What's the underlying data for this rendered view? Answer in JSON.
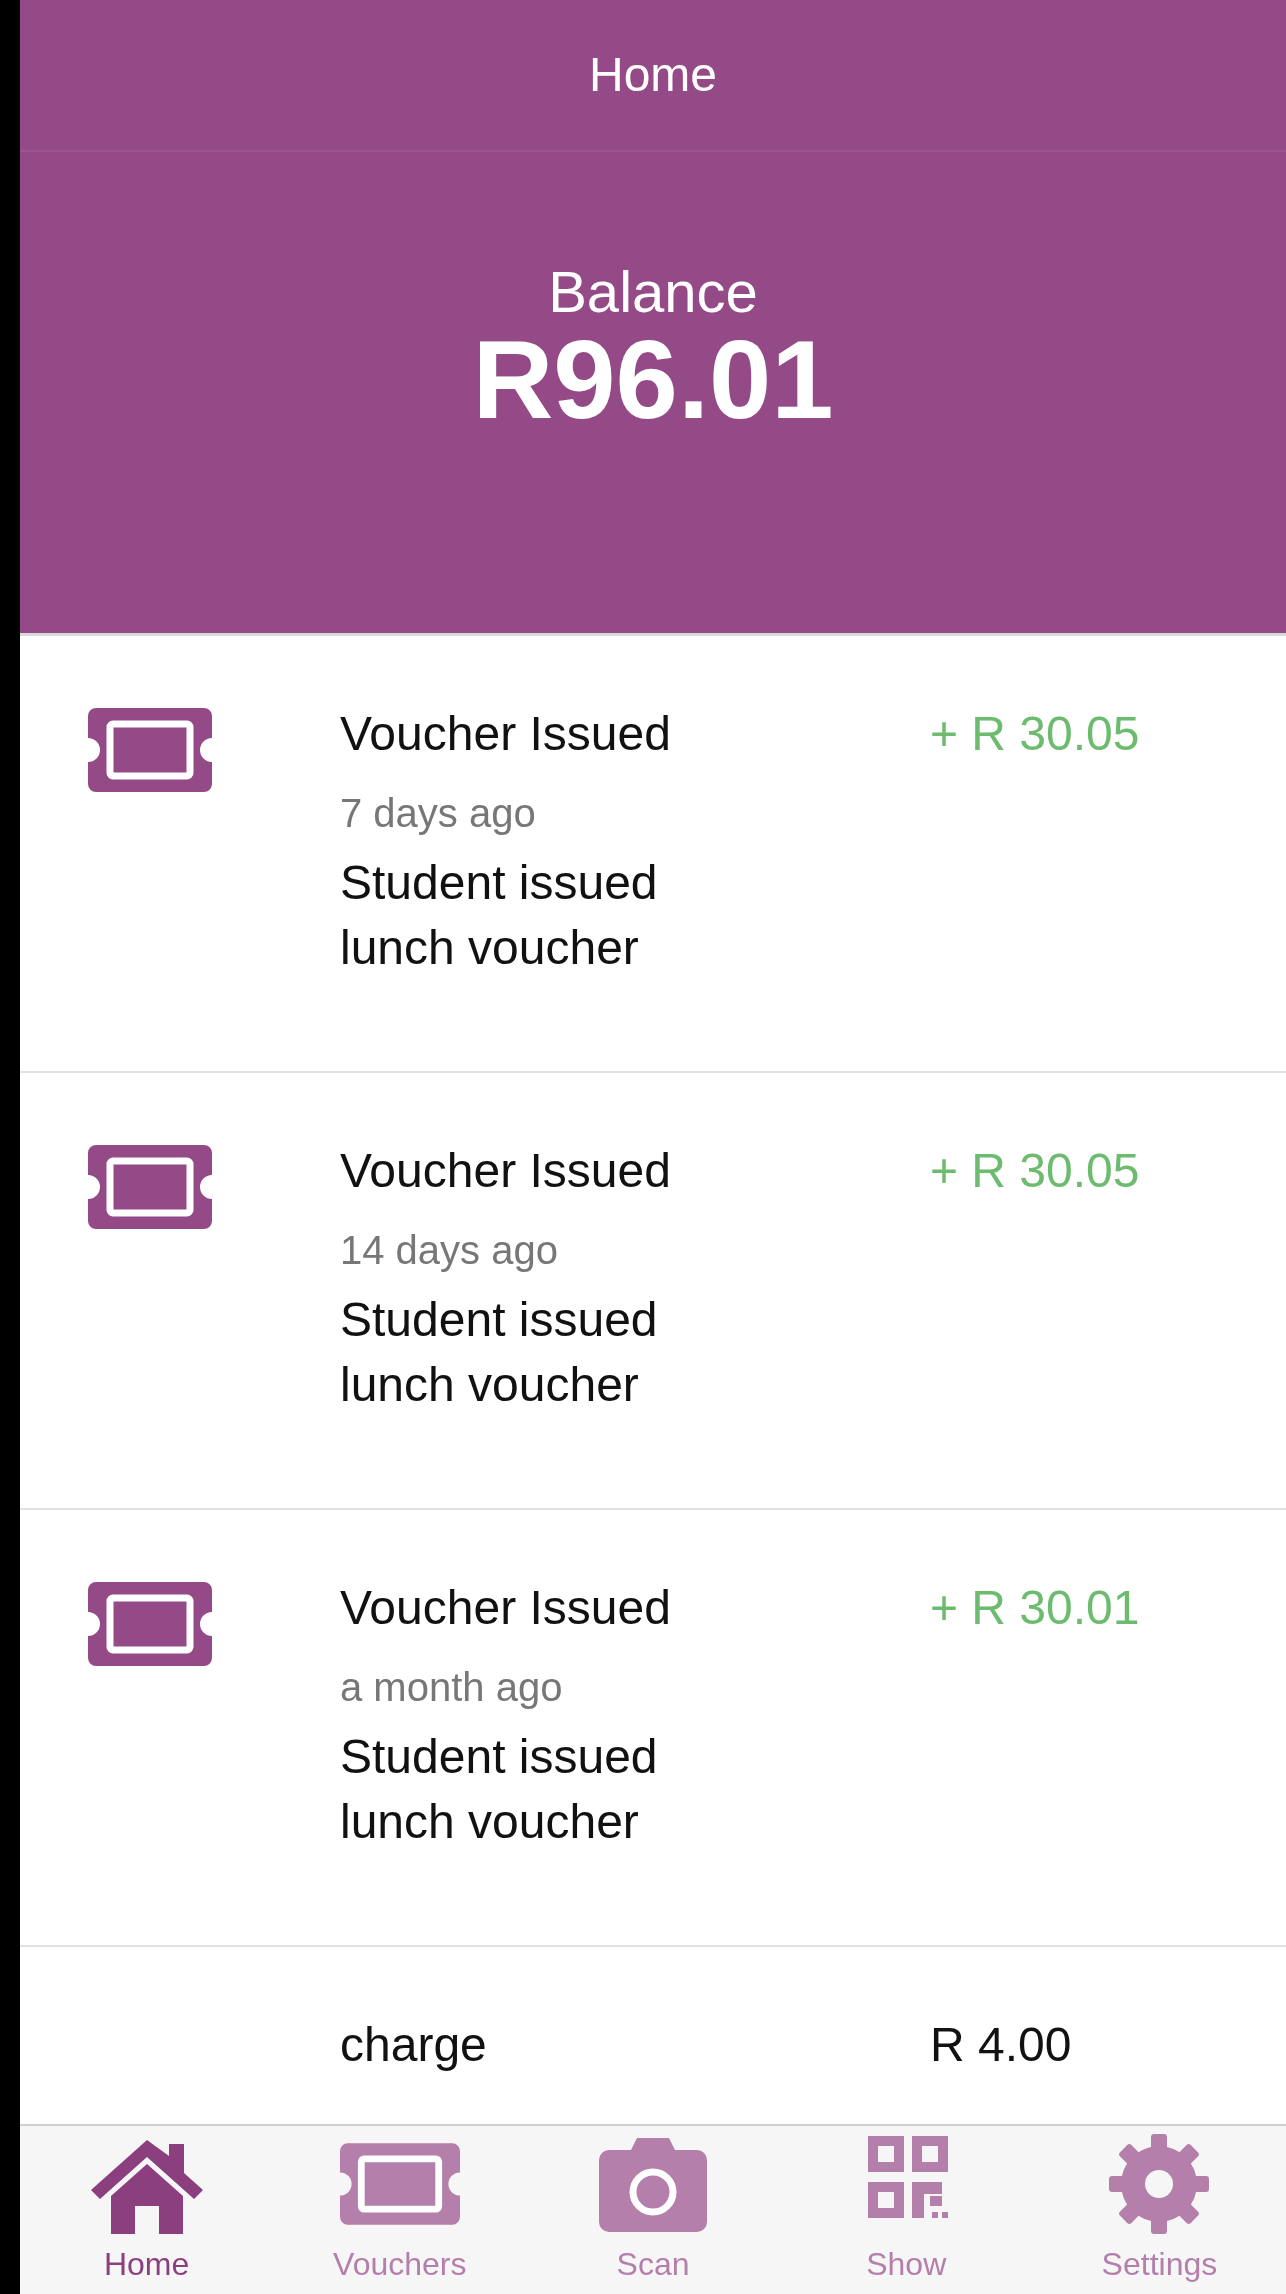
{
  "nav": {
    "title": "Home"
  },
  "balance": {
    "label": "Balance",
    "amount": "R96.01"
  },
  "transactions": [
    {
      "kind": "voucher",
      "title": "Voucher Issued",
      "time": "7 days ago",
      "description": "Student issued lunch voucher",
      "amount": "+ R 30.05"
    },
    {
      "kind": "voucher",
      "title": "Voucher Issued",
      "time": "14 days ago",
      "description": "Student issued lunch voucher",
      "amount": "+ R 30.05"
    },
    {
      "kind": "voucher",
      "title": "Voucher Issued",
      "time": "a month ago",
      "description": "Student issued lunch voucher",
      "amount": "+ R 30.01"
    },
    {
      "kind": "charge",
      "title": "charge",
      "amount": "R 4.00"
    }
  ],
  "tabs": [
    {
      "label": "Home",
      "selected": true
    },
    {
      "label": "Vouchers",
      "selected": false
    },
    {
      "label": "Scan",
      "selected": false
    },
    {
      "label": "Show",
      "selected": false
    },
    {
      "label": "Settings",
      "selected": false
    }
  ]
}
